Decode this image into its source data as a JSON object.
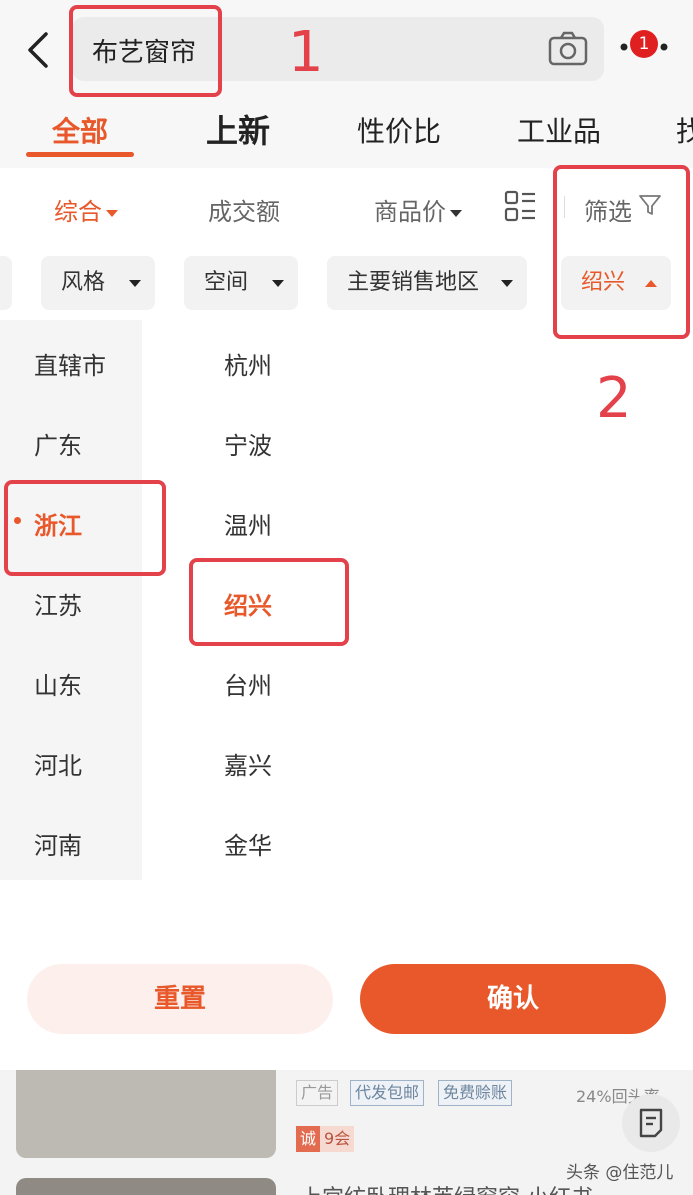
{
  "header": {
    "search_text": "布艺窗帘",
    "badge_count": "1",
    "tabs": [
      {
        "label": "全部"
      },
      {
        "label": "上新"
      },
      {
        "label": "性价比"
      },
      {
        "label": "工业品"
      },
      {
        "label": "找"
      }
    ]
  },
  "sortbar": {
    "items": [
      "综合",
      "成交额",
      "商品价"
    ],
    "filter_label": "筛选"
  },
  "chips": [
    {
      "label": "风格"
    },
    {
      "label": "空间"
    },
    {
      "label": "主要销售地区"
    },
    {
      "label": "绍兴"
    }
  ],
  "provinces": [
    "直辖市",
    "广东",
    "浙江",
    "江苏",
    "山东",
    "河北",
    "河南"
  ],
  "cities": [
    "杭州",
    "宁波",
    "温州",
    "绍兴",
    "台州",
    "嘉兴",
    "金华"
  ],
  "selected_province": "浙江",
  "selected_city": "绍兴",
  "buttons": {
    "reset": "重置",
    "confirm": "确认"
  },
  "products": {
    "tags": [
      "广告",
      "代发包邮",
      "免费赊账"
    ],
    "rate": "24%回头率",
    "cheng_a": "诚",
    "cheng_b": "9会",
    "title": "上宫纺卧理林芙绿窗帘 小红书"
  },
  "watermark": "头条 @住范儿",
  "annotations": {
    "box1_number": "1",
    "box2_number": "2"
  },
  "colors": {
    "accent": "#e8582a",
    "annotation": "#e3424b"
  }
}
